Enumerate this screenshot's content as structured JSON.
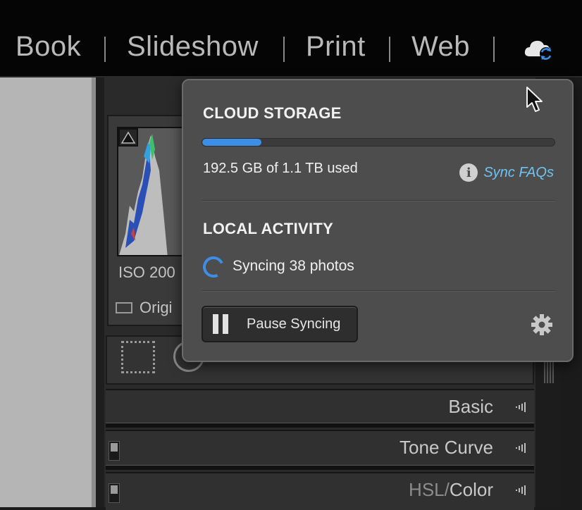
{
  "nav": {
    "items": [
      "Book",
      "Slideshow",
      "Print",
      "Web"
    ]
  },
  "icons": {
    "cloud_sync": "cloud-sync-icon",
    "info": "info-icon",
    "gear": "gear-icon",
    "pause": "pause-icon",
    "cursor": "cursor-arrow-icon"
  },
  "colors": {
    "accent": "#3d8ee6",
    "link": "#6fc3f0"
  },
  "panel": {
    "iso": "ISO 200",
    "original_label": "Origi",
    "sections": [
      {
        "title": "Basic"
      },
      {
        "title": "Tone Curve"
      },
      {
        "title_dim": "HSL",
        "slash": "/",
        "title_active": "Color"
      }
    ]
  },
  "popover": {
    "cloud_storage_heading": "CLOUD STORAGE",
    "storage_used_fraction": 0.167,
    "storage_text": "192.5 GB of 1.1 TB used",
    "info_glyph": "i",
    "sync_faqs_link": "Sync FAQs",
    "local_activity_heading": "LOCAL ACTIVITY",
    "syncing_text": "Syncing 38 photos",
    "pause_button_label": "Pause Syncing"
  }
}
